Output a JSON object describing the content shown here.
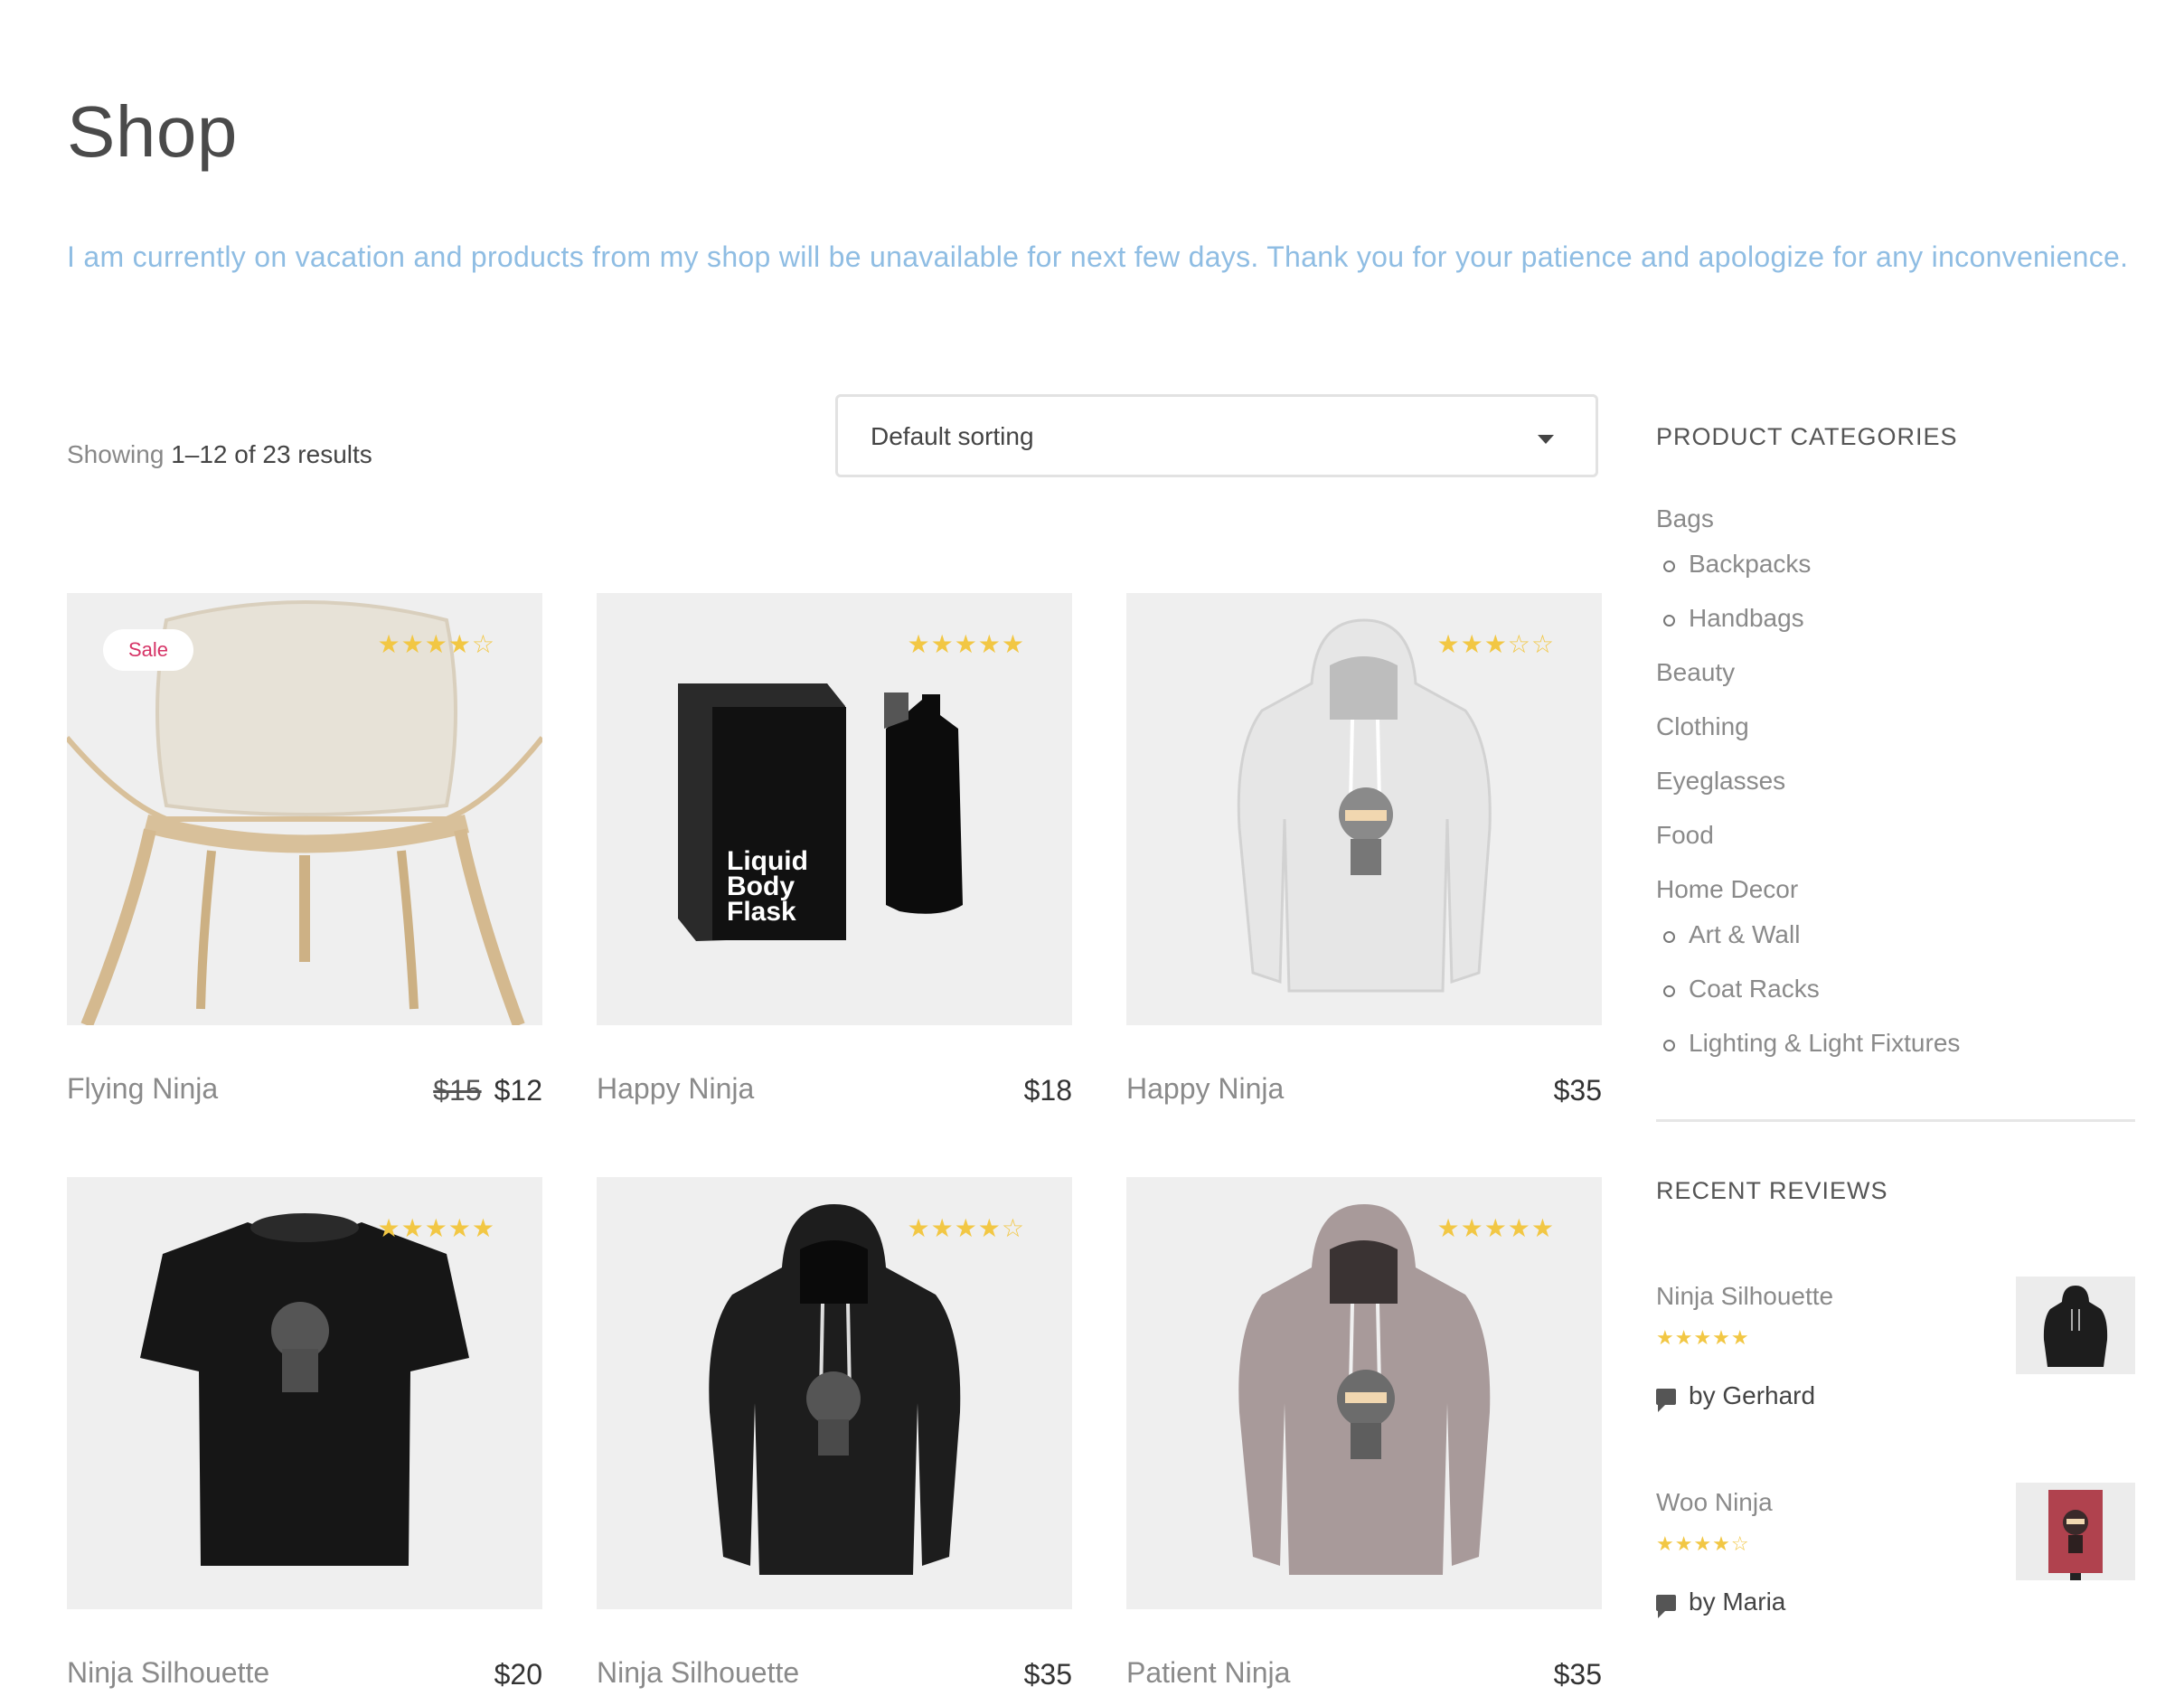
{
  "page": {
    "title": "Shop"
  },
  "notice": "I am currently on vacation and products from my shop will be unavailable for next few days. Thank you for your patience and apologize for any inconvenience.",
  "results": {
    "prefix": "Showing",
    "range": "1–12 of 23 results"
  },
  "sorting": {
    "selected": "Default sorting"
  },
  "products": [
    {
      "title": "Flying Ninja",
      "old_price": "$15",
      "price": "$12",
      "sale": "Sale",
      "stars": "★★★★☆",
      "rating": 4,
      "image": "chair"
    },
    {
      "title": "Happy Ninja",
      "price": "$18",
      "stars": "★★★★★",
      "rating": 5,
      "image": "liquid-body-flask",
      "image_text": [
        "Liquid",
        "Body",
        "Flask"
      ]
    },
    {
      "title": "Happy Ninja",
      "price": "$35",
      "stars": "★★★☆☆",
      "rating": 3,
      "image": "white-hoodie"
    },
    {
      "title": "Ninja Silhouette",
      "price": "$20",
      "stars": "★★★★★",
      "rating": 5,
      "image": "black-tshirt"
    },
    {
      "title": "Ninja Silhouette",
      "price": "$35",
      "stars": "★★★★☆",
      "rating": 4,
      "image": "black-hoodie"
    },
    {
      "title": "Patient Ninja",
      "price": "$35",
      "stars": "★★★★★",
      "rating": 5,
      "image": "mauve-hoodie"
    }
  ],
  "sidebar": {
    "categories_title": "PRODUCT CATEGORIES",
    "categories": [
      {
        "label": "Bags",
        "level": 0
      },
      {
        "label": "Backpacks",
        "level": 1
      },
      {
        "label": "Handbags",
        "level": 1
      },
      {
        "label": "Beauty",
        "level": 0
      },
      {
        "label": "Clothing",
        "level": 0
      },
      {
        "label": "Eyeglasses",
        "level": 0
      },
      {
        "label": "Food",
        "level": 0
      },
      {
        "label": "Home Decor",
        "level": 0
      },
      {
        "label": "Art & Wall",
        "level": 1
      },
      {
        "label": "Coat Racks",
        "level": 1
      },
      {
        "label": "Lighting & Light Fixtures",
        "level": 1
      }
    ],
    "reviews_title": "RECENT REVIEWS",
    "reviews": [
      {
        "product": "Ninja Silhouette",
        "stars": "★★★★★",
        "rating": 5,
        "author": "by Gerhard",
        "image": "black-hoodie"
      },
      {
        "product": "Woo Ninja",
        "stars": "★★★★☆",
        "rating": 4,
        "author": "by Maria",
        "image": "poster"
      }
    ]
  },
  "colors": {
    "star": "#f2c744",
    "sale": "#d63366",
    "notice": "#8fbde3"
  }
}
